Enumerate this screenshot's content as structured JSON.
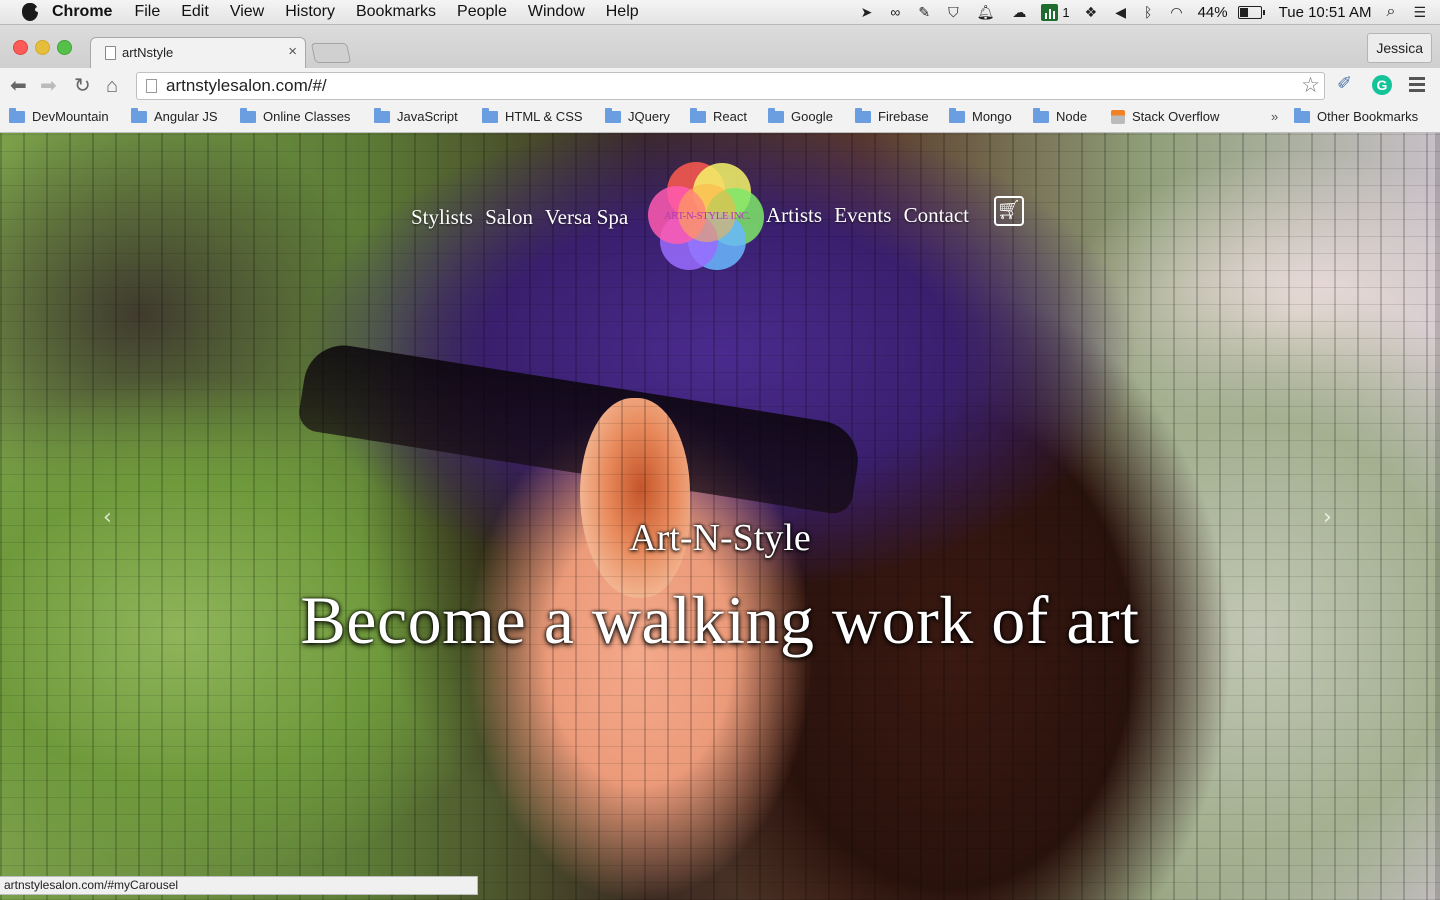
{
  "menubar": {
    "app": "Chrome",
    "items": [
      "File",
      "Edit",
      "View",
      "History",
      "Bookmarks",
      "People",
      "Window",
      "Help"
    ],
    "badge_count": "1",
    "battery": "44%",
    "battery_level": 0.44,
    "clock": "Tue 10:51 AM"
  },
  "browser": {
    "tab_title": "artNstyle",
    "tab_close": "×",
    "profile": "Jessica",
    "url": "artnstylesalon.com/#/",
    "bookmarks": [
      "DevMountain",
      "Angular JS",
      "Online Classes",
      "JavaScript",
      "HTML & CSS",
      "JQuery",
      "React",
      "Google",
      "Firebase",
      "Mongo",
      "Node",
      "Stack Overflow"
    ],
    "overflow": "»",
    "other_bookmarks": "Other Bookmarks",
    "status_url": "artnstylesalon.com/#myCarousel",
    "icons": {
      "back": "back-arrow-icon",
      "forward": "forward-arrow-icon",
      "reload": "reload-icon",
      "home": "home-icon",
      "bookmark_star": "star-icon",
      "extension": "eyedropper-icon",
      "grammarly": "grammarly-icon",
      "menu": "hamburger-menu-icon"
    }
  },
  "site": {
    "nav_left": [
      "Stylists",
      "Salon",
      "Versa Spa"
    ],
    "logo_text": "ART-N-STYLE INC.",
    "nav_right": [
      "Artists",
      "Events",
      "Contact"
    ],
    "cart_icon": "shopping-cart-icon",
    "carousel": {
      "subtitle": "Art-N-Style",
      "title": "Become a walking work of art",
      "prev": "‹",
      "next": "›"
    }
  },
  "colors": {
    "logo_petals": [
      "#ff5a4f",
      "#ffb347",
      "#f5f56a",
      "#7ee86a",
      "#6ab8ff",
      "#9a6cff",
      "#ff5ab0"
    ],
    "grammarly": "#15c39a",
    "folder": "#6b9ee0"
  }
}
